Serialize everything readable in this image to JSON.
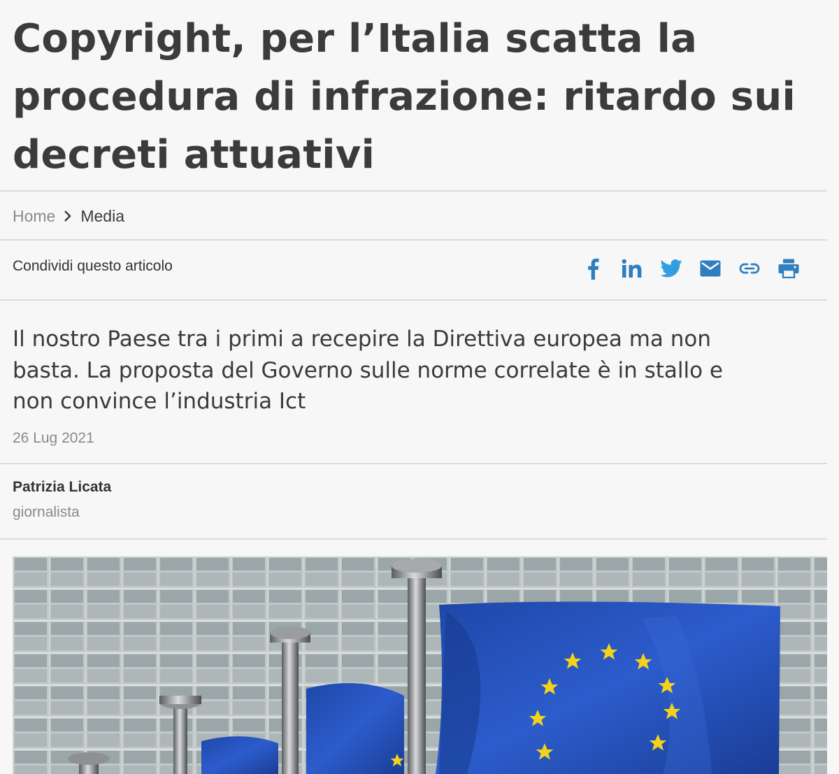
{
  "article": {
    "title_lines": [
      "Copyright, per l’Italia scatta la",
      "procedura di infrazione: ritardo sui",
      "decreti attuativi"
    ],
    "subtitle_lines": [
      "Il nostro Paese tra i primi a recepire la Direttiva europea ma non",
      "basta. La proposta del Governo sulle norme correlate è in stallo e",
      "non convince l’industria Ict"
    ],
    "date": "26 Lug 2021"
  },
  "breadcrumb": {
    "home": "Home",
    "current": "Media"
  },
  "share": {
    "label": "Condividi questo articolo",
    "accent_color": "#2f7fc0",
    "icons": [
      "facebook-icon",
      "linkedin-icon",
      "twitter-icon",
      "email-icon",
      "link-icon",
      "print-icon"
    ]
  },
  "author": {
    "name": "Patrizia Licata",
    "role": "giornalista"
  },
  "hero_image": {
    "subject": "EU flags in front of glass building facade"
  }
}
